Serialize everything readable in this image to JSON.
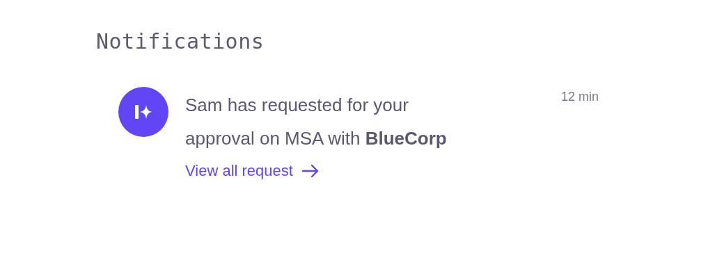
{
  "title": "Notifications",
  "notifications": [
    {
      "message": "Sam has requested for your approval on MSA with **BlueCorp**",
      "time": "12 min",
      "link": "View all request"
    }
  ]
}
